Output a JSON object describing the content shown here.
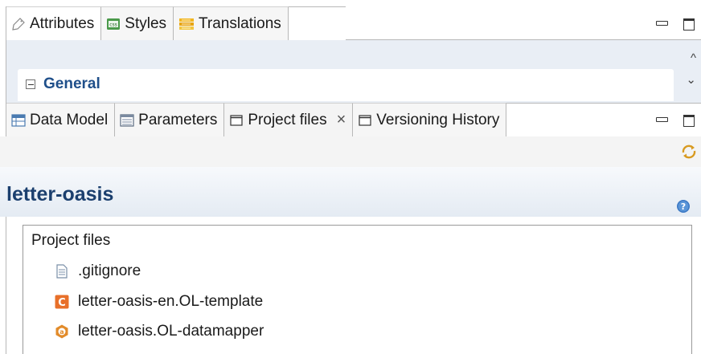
{
  "top_panel": {
    "tabs": [
      {
        "label": "Attributes",
        "icon": "tag-icon"
      },
      {
        "label": "Styles",
        "icon": "css-icon"
      },
      {
        "label": "Translations",
        "icon": "translations-icon"
      }
    ],
    "section_label": "General"
  },
  "bottom_panel": {
    "tabs": [
      {
        "label": "Data Model",
        "icon": "data-model-icon"
      },
      {
        "label": "Parameters",
        "icon": "parameters-icon"
      },
      {
        "label": "Project files",
        "icon": "project-files-icon",
        "close": "×"
      },
      {
        "label": "Versioning History",
        "icon": "versioning-icon"
      }
    ]
  },
  "project": {
    "title": "letter-oasis",
    "files_heading": "Project files",
    "files": [
      {
        "name": ".gitignore",
        "icon": "text-file-icon"
      },
      {
        "name": "letter-oasis-en.OL-template",
        "icon": "template-file-icon"
      },
      {
        "name": "letter-oasis.OL-datamapper",
        "icon": "datamapper-file-icon"
      }
    ]
  },
  "colors": {
    "title_blue": "#1b3f6e",
    "section_blue": "#1f4f8a",
    "template_orange": "#e8702a",
    "datamapper_orange": "#e28b2a"
  }
}
